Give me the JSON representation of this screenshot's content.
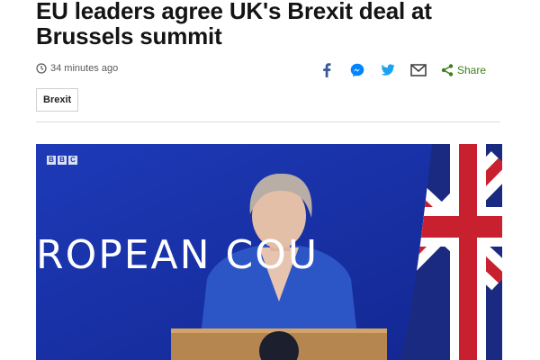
{
  "article": {
    "headline": "EU leaders agree UK's Brexit deal at Brussels summit",
    "timestamp": "34 minutes ago",
    "tag": "Brexit"
  },
  "share": {
    "icons": [
      "facebook-icon",
      "messenger-icon",
      "twitter-icon",
      "email-icon",
      "share-icon"
    ],
    "share_label": "Share"
  },
  "video": {
    "channel_logo_letters": [
      "B",
      "B",
      "C"
    ],
    "backdrop_text": "ROPEAN COU"
  },
  "colors": {
    "text": "#141414",
    "muted": "#5a5a5a",
    "facebook": "#3b5998",
    "messenger": "#0084ff",
    "twitter": "#1da1f2",
    "share_green": "#3d7f1a",
    "stage_blue": "#1730a7"
  }
}
